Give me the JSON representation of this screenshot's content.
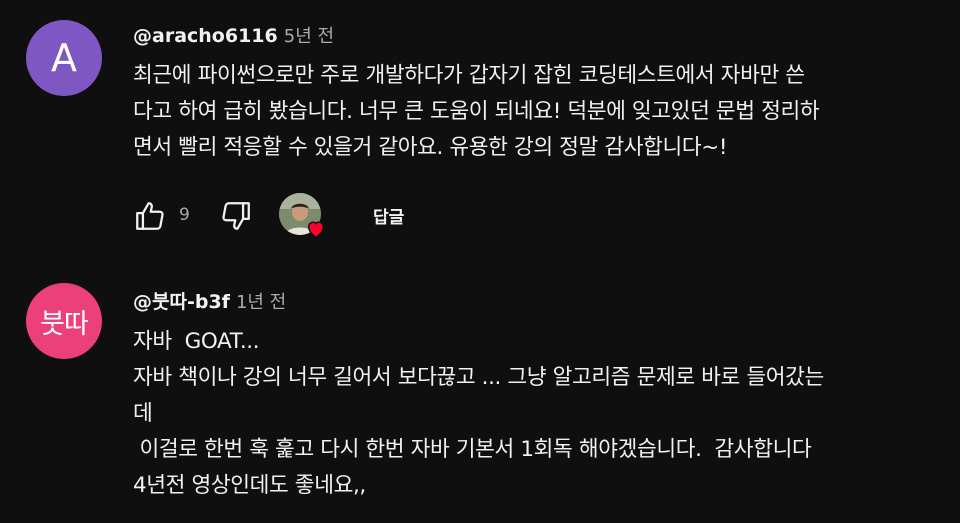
{
  "comments": [
    {
      "avatar_text": "A",
      "author": "@aracho6116",
      "time": "5년 전",
      "text": "최근에 파이썬으로만 주로 개발하다가 갑자기 잡힌 코딩테스트에서 자바만 쓴\n다고 하여 급히 봤습니다. 너무 큰 도움이 되네요! 덕분에 잊고있던 문법 정리하\n면서 빨리 적응할 수 있을거 같아요. 유용한 강의 정말 감사합니다~!",
      "like_count": "9",
      "reply_label": "답글"
    },
    {
      "avatar_text": "붓따",
      "author": "@붓따-b3f",
      "time": "1년 전",
      "text": "자바  GOAT...\n자바 책이나 강의 너무 길어서 보다끊고 ... 그냥 알고리즘 문제로 바로 들어갔는\n데\n 이걸로 한번 훅 훑고 다시 한번 자바 기본서 1회독 해야겠습니다.  감사합니다\n4년전 영상인데도 좋네요,,"
    }
  ],
  "colors": {
    "background": "#0f0f0f",
    "avatar_a": "#7e57c2",
    "avatar_b": "#ec407a",
    "heart": "#ff0033",
    "secondary_text": "#aaaaaa"
  },
  "icons": {
    "like": "thumbs-up-icon",
    "dislike": "thumbs-down-icon",
    "creator_heart": "heart-icon"
  }
}
